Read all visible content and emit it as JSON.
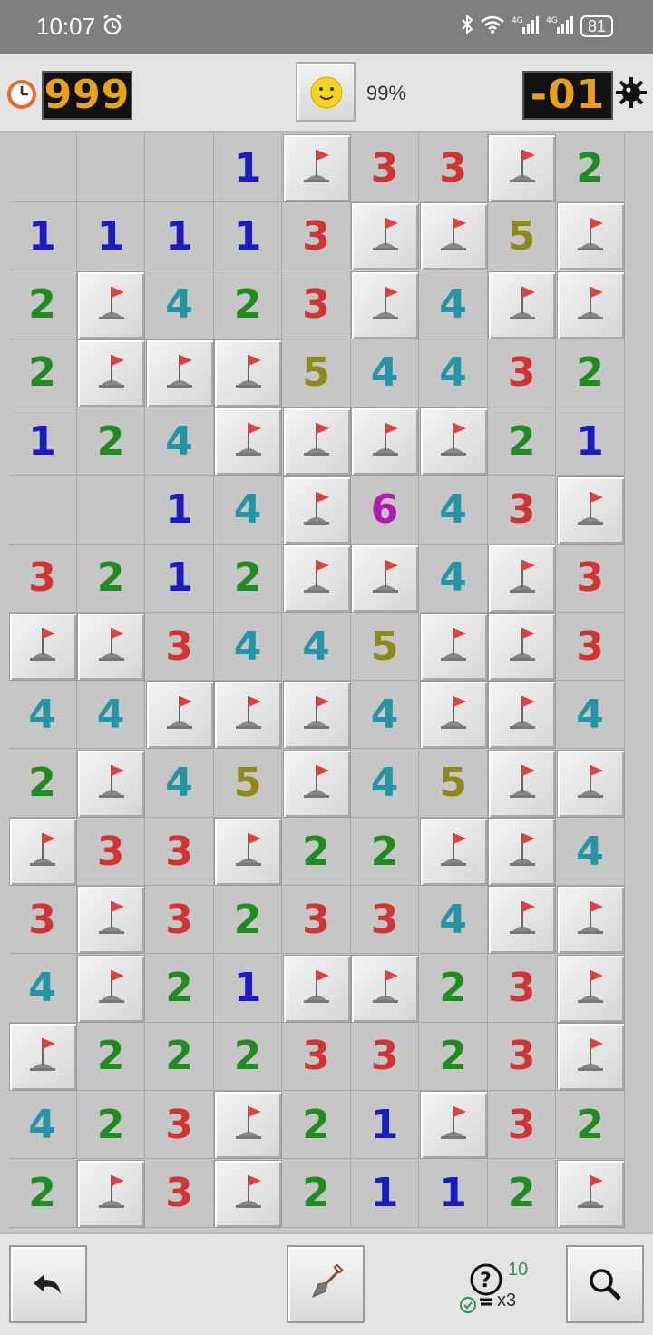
{
  "status_bar": {
    "time": "10:07",
    "battery": "81"
  },
  "header": {
    "timer": "999",
    "mines_left": "-01",
    "progress": "99%"
  },
  "board": {
    "rows": [
      [
        "",
        "",
        "",
        "1",
        "F",
        "3",
        "3",
        "F",
        "2"
      ],
      [
        "1",
        "1",
        "1",
        "1",
        "3",
        "F",
        "F",
        "5",
        "F"
      ],
      [
        "2",
        "F",
        "4",
        "2",
        "3",
        "F",
        "4",
        "F",
        "F"
      ],
      [
        "2",
        "F",
        "F",
        "F",
        "5",
        "4",
        "4",
        "3",
        "2"
      ],
      [
        "1",
        "2",
        "4",
        "F",
        "F",
        "F",
        "F",
        "2",
        "1"
      ],
      [
        "",
        "",
        "1",
        "4",
        "F",
        "6",
        "4",
        "3",
        "F"
      ],
      [
        "3",
        "2",
        "1",
        "2",
        "F",
        "F",
        "4",
        "F",
        "3"
      ],
      [
        "F",
        "F",
        "3",
        "4",
        "4",
        "5",
        "F",
        "F",
        "3"
      ],
      [
        "4",
        "4",
        "F",
        "F",
        "F",
        "4",
        "F",
        "F",
        "4"
      ],
      [
        "2",
        "F",
        "4",
        "5",
        "F",
        "4",
        "5",
        "F",
        "F"
      ],
      [
        "F",
        "3",
        "3",
        "F",
        "2",
        "2",
        "F",
        "F",
        "4"
      ],
      [
        "3",
        "F",
        "3",
        "2",
        "3",
        "3",
        "4",
        "F",
        "F"
      ],
      [
        "4",
        "F",
        "2",
        "1",
        "F",
        "F",
        "2",
        "3",
        "F"
      ],
      [
        "F",
        "2",
        "2",
        "2",
        "3",
        "3",
        "2",
        "3",
        "F"
      ],
      [
        "4",
        "2",
        "3",
        "F",
        "2",
        "1",
        "F",
        "3",
        "2"
      ],
      [
        "2",
        "F",
        "3",
        "F",
        "2",
        "1",
        "1",
        "2",
        "F"
      ]
    ]
  },
  "footer": {
    "hint_count": "10",
    "hint_multiplier": "x3"
  },
  "colors": {
    "timer_digits": "#e8a21a",
    "status_bar": "#7f7f7f"
  }
}
